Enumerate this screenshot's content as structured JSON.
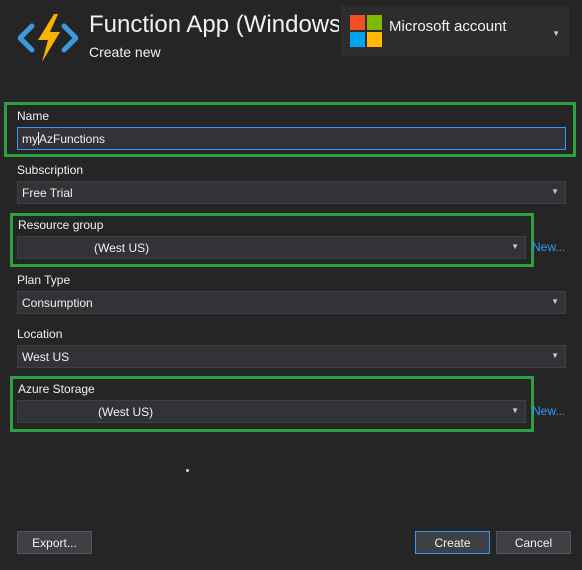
{
  "header": {
    "title": "Function App (Windows)",
    "subtitle": "Create new",
    "icon": "azure-functions-lightning-icon"
  },
  "account": {
    "label": "Microsoft account",
    "icon": "microsoft-logo-icon"
  },
  "form": {
    "name": {
      "label": "Name",
      "value_before_cursor": "my",
      "value_after_cursor": "AzFunctions"
    },
    "subscription": {
      "label": "Subscription",
      "value": "Free Trial"
    },
    "resource_group": {
      "label": "Resource group",
      "value": "(West US)",
      "new_link": "New..."
    },
    "plan_type": {
      "label": "Plan Type",
      "value": "Consumption"
    },
    "location": {
      "label": "Location",
      "value": "West US"
    },
    "azure_storage": {
      "label": "Azure Storage",
      "value": "(West US)",
      "new_link": "New..."
    }
  },
  "buttons": {
    "export": "Export...",
    "create": "Create",
    "cancel": "Cancel"
  },
  "colors": {
    "background": "#252526",
    "field_bg": "#333337",
    "highlight": "#2ea043",
    "link": "#3399ff"
  }
}
